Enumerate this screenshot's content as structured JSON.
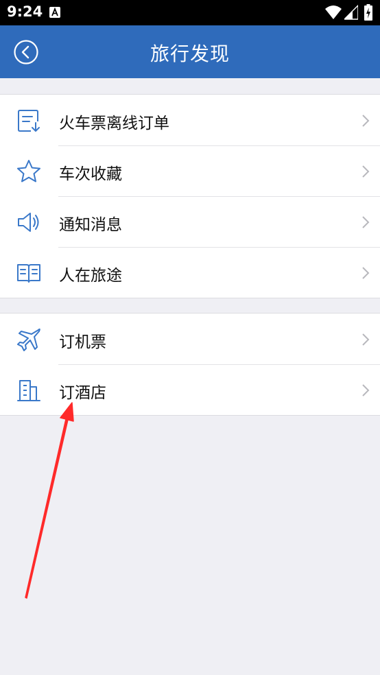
{
  "status_bar": {
    "time": "9:24",
    "icons": [
      "a-notification-icon",
      "wifi-icon",
      "signal-icon",
      "battery-charging-icon"
    ]
  },
  "header": {
    "title": "旅行发现",
    "back_icon": "back-circle-icon",
    "background": "#2f6bbb"
  },
  "groups": [
    {
      "items": [
        {
          "label": "火车票离线订单",
          "icon": "offline-order-icon"
        },
        {
          "label": "车次收藏",
          "icon": "star-icon"
        },
        {
          "label": "通知消息",
          "icon": "speaker-icon"
        },
        {
          "label": "人在旅途",
          "icon": "book-icon"
        }
      ]
    },
    {
      "items": [
        {
          "label": "订机票",
          "icon": "airplane-icon"
        },
        {
          "label": "订酒店",
          "icon": "hotel-building-icon"
        }
      ]
    }
  ],
  "colors": {
    "icon_blue": "#3a78c9",
    "background": "#efeff4",
    "annotation_arrow": "#ff2a2a"
  }
}
